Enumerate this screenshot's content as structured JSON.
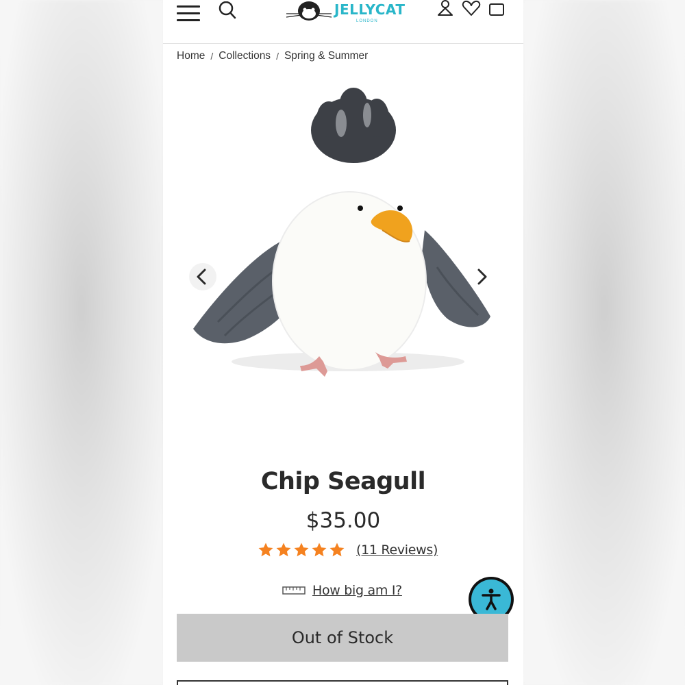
{
  "header": {
    "logo_text": "JELLYCAT",
    "logo_sub": "LONDON"
  },
  "breadcrumb": {
    "items": [
      "Home",
      "Collections",
      "Spring & Summer"
    ],
    "separator": "/"
  },
  "product": {
    "title": "Chip Seagull",
    "price": "$35.00",
    "rating": 5,
    "reviews_label": "(11 Reviews)",
    "size_guide_label": "How big am I?",
    "stock_button_label": "Out of Stock"
  },
  "colors": {
    "brand": "#29b6c9",
    "star": "#f58220",
    "button_disabled": "#c9c9c9",
    "accessibility": "#3ab8d6"
  },
  "icons": [
    "menu-icon",
    "search-icon",
    "account-icon",
    "heart-icon",
    "bag-icon",
    "chevron-left-icon",
    "chevron-right-icon",
    "star-icon",
    "ruler-icon",
    "accessibility-icon"
  ]
}
